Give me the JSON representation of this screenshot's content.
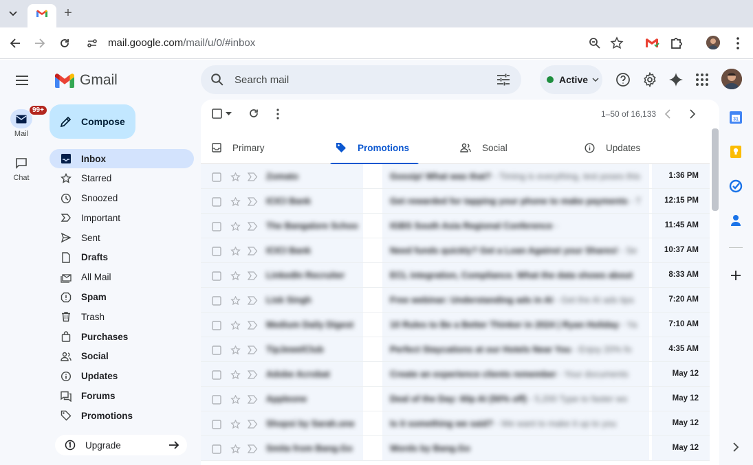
{
  "browser": {
    "url_host": "mail.google.com",
    "url_path": "/mail/u/0/#inbox"
  },
  "app": {
    "logo_text": "Gmail",
    "compose_label": "Compose",
    "rail": [
      {
        "label": "Mail",
        "badge": "99+"
      },
      {
        "label": "Chat"
      }
    ],
    "nav": [
      {
        "label": "Inbox",
        "icon": "inbox-icon",
        "active": true
      },
      {
        "label": "Starred",
        "icon": "star-icon"
      },
      {
        "label": "Snoozed",
        "icon": "clock-icon"
      },
      {
        "label": "Important",
        "icon": "label-important-icon"
      },
      {
        "label": "Sent",
        "icon": "send-icon"
      },
      {
        "label": "Drafts",
        "icon": "draft-icon",
        "bold": true
      },
      {
        "label": "All Mail",
        "icon": "all-mail-icon"
      },
      {
        "label": "Spam",
        "icon": "spam-icon",
        "bold": true
      },
      {
        "label": "Trash",
        "icon": "trash-icon"
      },
      {
        "label": "Purchases",
        "icon": "shopping-bag-icon",
        "bold": true
      },
      {
        "label": "Social",
        "icon": "people-icon",
        "bold": true
      },
      {
        "label": "Updates",
        "icon": "info-icon",
        "bold": true
      },
      {
        "label": "Forums",
        "icon": "forum-icon",
        "bold": true
      },
      {
        "label": "Promotions",
        "icon": "tag-icon",
        "bold": true
      }
    ],
    "upgrade_label": "Upgrade",
    "search_placeholder": "Search mail",
    "status_label": "Active",
    "pager": "1–50 of 16,133",
    "tabs": [
      {
        "label": "Primary",
        "icon": "inbox-icon"
      },
      {
        "label": "Promotions",
        "icon": "tag-icon",
        "active": true
      },
      {
        "label": "Social",
        "icon": "people-icon"
      },
      {
        "label": "Updates",
        "icon": "info-icon"
      }
    ],
    "emails": [
      {
        "sender": "Zomato",
        "subject": "Gossip! What was that?",
        "snippet": " - Timing is everything, test poses this",
        "time": "1:36 PM"
      },
      {
        "sender": "ICICI Bank",
        "subject": "Get rewarded for tapping your phone to make payments",
        "snippet": " - T",
        "time": "12:15 PM"
      },
      {
        "sender": "The Bangalore Schoo",
        "subject": "IGBS South Asia Regional Conference",
        "snippet": " - ",
        "time": "11:45 AM"
      },
      {
        "sender": "ICICI Bank",
        "subject": "Need funds quickly? Get a Loan Against your Shares!",
        "snippet": " - Se",
        "time": "10:37 AM"
      },
      {
        "sender": "LinkedIn Recruiter",
        "subject": "ECL integration, Compliance. What the data shows about",
        "snippet": "",
        "time": "8:33 AM"
      },
      {
        "sender": "Lisk Singh",
        "subject": "Free webinar: Understanding ads in AI",
        "snippet": " - Get the AI ads tips",
        "time": "7:20 AM"
      },
      {
        "sender": "Medium Daily Digest",
        "subject": "10 Rules to Be a Better Thinker in 2024 | Ryan Holiday",
        "snippet": " - Ya",
        "time": "7:10 AM"
      },
      {
        "sender": "TipJewelClub",
        "subject": "Perfect Staycations at our Hotels Near You",
        "snippet": " - Enjoy 20% fo",
        "time": "4:35 AM"
      },
      {
        "sender": "Adobe Acrobat",
        "subject": "Create an experience clients remember",
        "snippet": " - Your documents",
        "time": "May 12"
      },
      {
        "sender": "Appleone",
        "subject": "Deal of the Day: 60p AI (50% off)",
        "snippet": " - 5,200 Type to faster wo",
        "time": "May 12"
      },
      {
        "sender": "Shopsi by Sarah.one",
        "subject": "Is it something we said?",
        "snippet": " - We want to make it up to you",
        "time": "May 12"
      },
      {
        "sender": "Smita from Bang.Go",
        "subject": "Words by Bang.Go",
        "snippet": "",
        "time": "May 12"
      }
    ]
  },
  "colors": {
    "accent": "#0b57d0",
    "compose_bg": "#c2e7ff",
    "nav_active": "#d3e3fd",
    "badge": "#b3261e",
    "status_dot": "#1e8e3e"
  }
}
